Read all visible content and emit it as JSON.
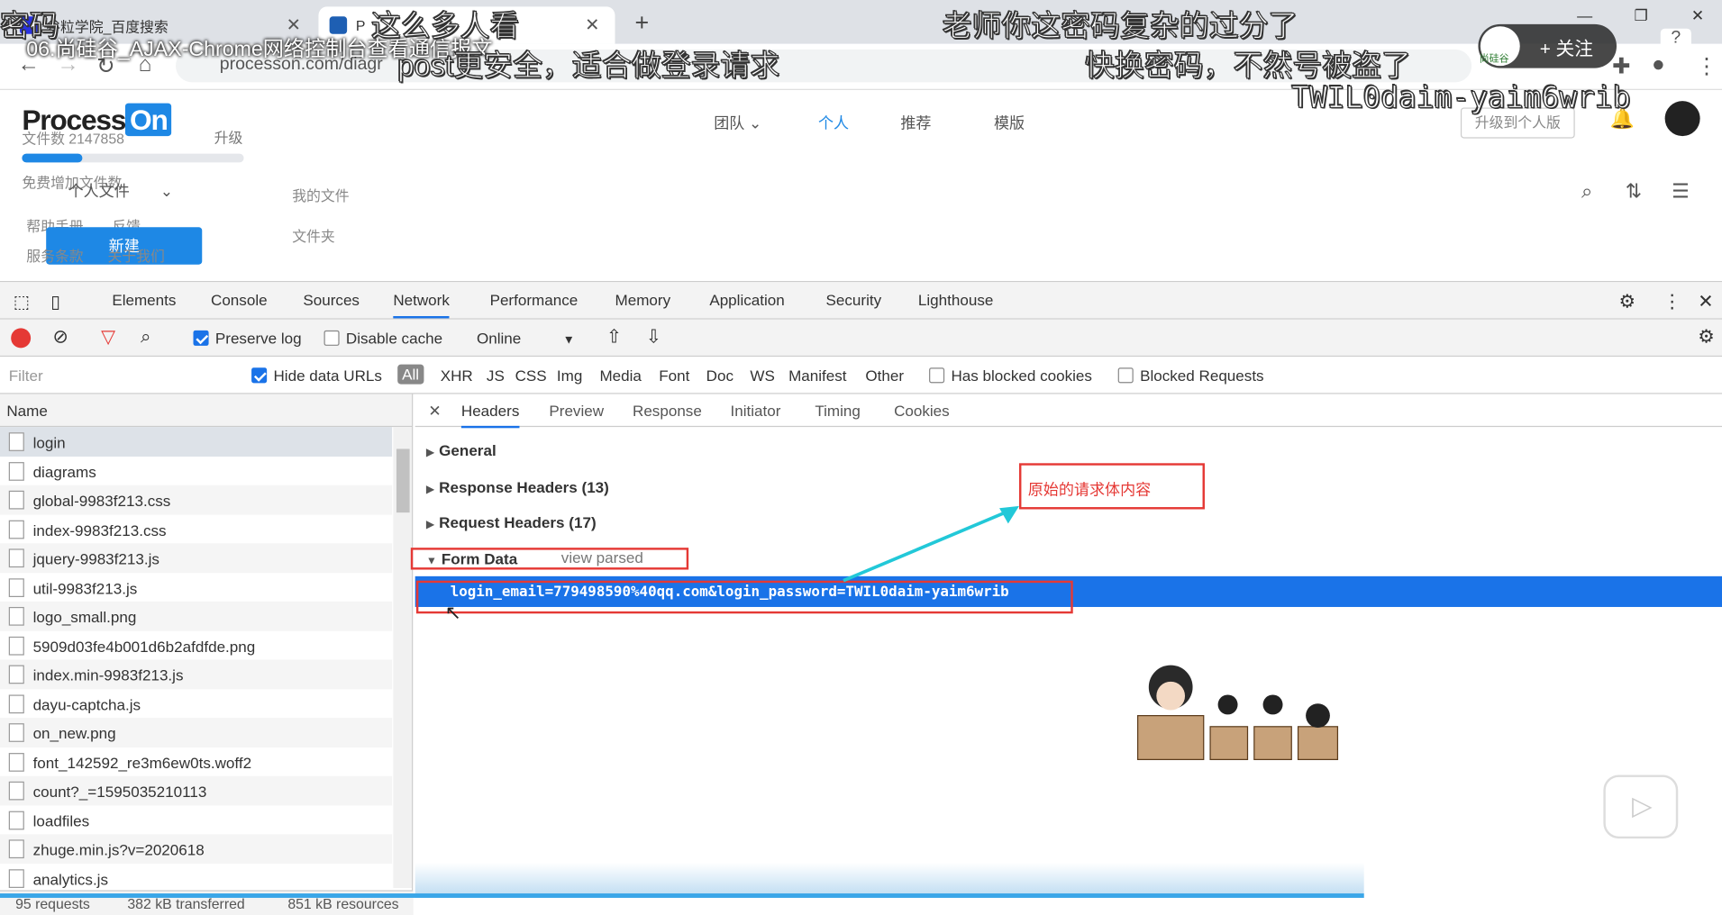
{
  "browser": {
    "tabs": [
      {
        "label": "谷粒学院_百度搜索"
      },
      {
        "label": "P"
      }
    ],
    "url": "processon.com/diagr"
  },
  "video_overlay": {
    "title": "06.尚硅谷_AJAX-Chrome网络控制台查看通信报文",
    "danmaku": [
      "密码",
      "这么多人看",
      "老师你这密码复杂的过分了",
      "post更安全，适合做登录请求",
      "快换密码，不然号被盗了",
      "TWIL0daim-yaim6wrib"
    ],
    "follow_label": "关注",
    "badge_text": "尚硅谷"
  },
  "page": {
    "logo_text": "Process",
    "logo_on": "On",
    "file_count": "文件数 2147858",
    "upgrade": "升级",
    "nav": [
      "团队",
      "个人",
      "推荐",
      "模版"
    ],
    "upgrade_personal": "升级到个人版",
    "add_files": "免费增加文件数",
    "personal_files": "个人文件",
    "help": "帮助手册",
    "feedback": "反馈",
    "terms": "服务条款",
    "about": "关于我们",
    "new_button": "新建",
    "my_files": "我的文件",
    "folder": "文件夹",
    "storage_progress": 0.27
  },
  "devtools": {
    "tabs": [
      "Elements",
      "Console",
      "Sources",
      "Network",
      "Performance",
      "Memory",
      "Application",
      "Security",
      "Lighthouse"
    ],
    "active_tab": "Network",
    "preserve_log": "Preserve log",
    "disable_cache": "Disable cache",
    "throttle": "Online",
    "filter_placeholder": "Filter",
    "hide_data_urls": "Hide data URLs",
    "filters": [
      "All",
      "XHR",
      "JS",
      "CSS",
      "Img",
      "Media",
      "Font",
      "Doc",
      "WS",
      "Manifest",
      "Other"
    ],
    "has_blocked_cookies": "Has blocked cookies",
    "blocked_requests": "Blocked Requests",
    "name_header": "Name",
    "requests": [
      "login",
      "diagrams",
      "global-9983f213.css",
      "index-9983f213.css",
      "jquery-9983f213.js",
      "util-9983f213.js",
      "logo_small.png",
      "5909d03fe4b001d6b2afdfde.png",
      "index.min-9983f213.js",
      "dayu-captcha.js",
      "on_new.png",
      "font_142592_re3m6ew0ts.woff2",
      "count?_=1595035210113",
      "loadfiles",
      "zhuge.min.js?v=2020618",
      "analytics.js"
    ],
    "status": {
      "requests": "95 requests",
      "transferred": "382 kB transferred",
      "resources": "851 kB resources"
    },
    "detail_tabs": [
      "Headers",
      "Preview",
      "Response",
      "Initiator",
      "Timing",
      "Cookies"
    ],
    "sections": {
      "general": "General",
      "response_headers": "Response Headers (13)",
      "request_headers": "Request Headers (17)",
      "form_data": "Form Data",
      "view_parsed": "view parsed"
    },
    "form_body": "login_email=779498590%40qq.com&login_password=TWIL0daim-yaim6wrib",
    "annotation": "原始的请求体内容"
  }
}
